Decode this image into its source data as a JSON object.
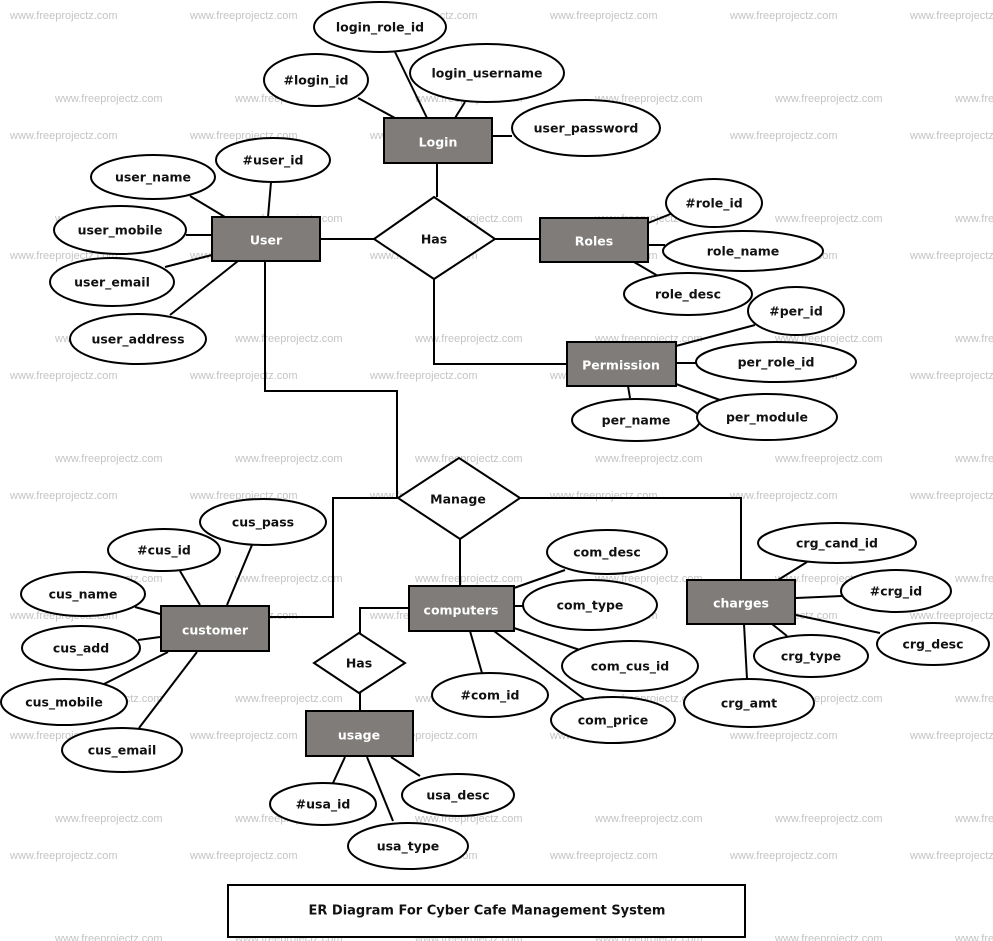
{
  "diagram": {
    "title": "ER Diagram For Cyber Cafe Management System",
    "watermark": "www.freeprojectz.com",
    "colors": {
      "entity_fill": "#7f7c7a",
      "entity_text": "#ffffff",
      "stroke": "#000000",
      "watermark": "#c4c4c4"
    },
    "entities": [
      {
        "id": "login",
        "label": "Login"
      },
      {
        "id": "user",
        "label": "User"
      },
      {
        "id": "roles",
        "label": "Roles"
      },
      {
        "id": "permission",
        "label": "Permission"
      },
      {
        "id": "customer",
        "label": "customer"
      },
      {
        "id": "computers",
        "label": "computers"
      },
      {
        "id": "charges",
        "label": "charges"
      },
      {
        "id": "usage",
        "label": "usage"
      }
    ],
    "relationships": [
      {
        "id": "has1",
        "label": "Has",
        "connects": [
          "user",
          "login",
          "roles",
          "permission"
        ]
      },
      {
        "id": "manage",
        "label": "Manage",
        "connects": [
          "user",
          "customer",
          "computers",
          "charges"
        ]
      },
      {
        "id": "has2",
        "label": "Has",
        "connects": [
          "computers",
          "usage"
        ]
      }
    ],
    "attributes": {
      "login": [
        "login_role_id",
        "#login_id",
        "login_username",
        "user_password"
      ],
      "user": [
        "#user_id",
        "user_name",
        "user_mobile",
        "user_email",
        "user_address"
      ],
      "roles": [
        "#role_id",
        "role_name",
        "role_desc"
      ],
      "permission": [
        "#per_id",
        "per_role_id",
        "per_name",
        "per_module"
      ],
      "customer": [
        "cus_pass",
        "#cus_id",
        "cus_name",
        "cus_add",
        "cus_mobile",
        "cus_email"
      ],
      "computers": [
        "com_desc",
        "com_type",
        "com_cus_id",
        "#com_id",
        "com_price"
      ],
      "charges": [
        "crg_cand_id",
        "#crg_id",
        "crg_desc",
        "crg_type",
        "crg_amt"
      ],
      "usage": [
        "#usa_id",
        "usa_desc",
        "usa_type"
      ]
    }
  }
}
